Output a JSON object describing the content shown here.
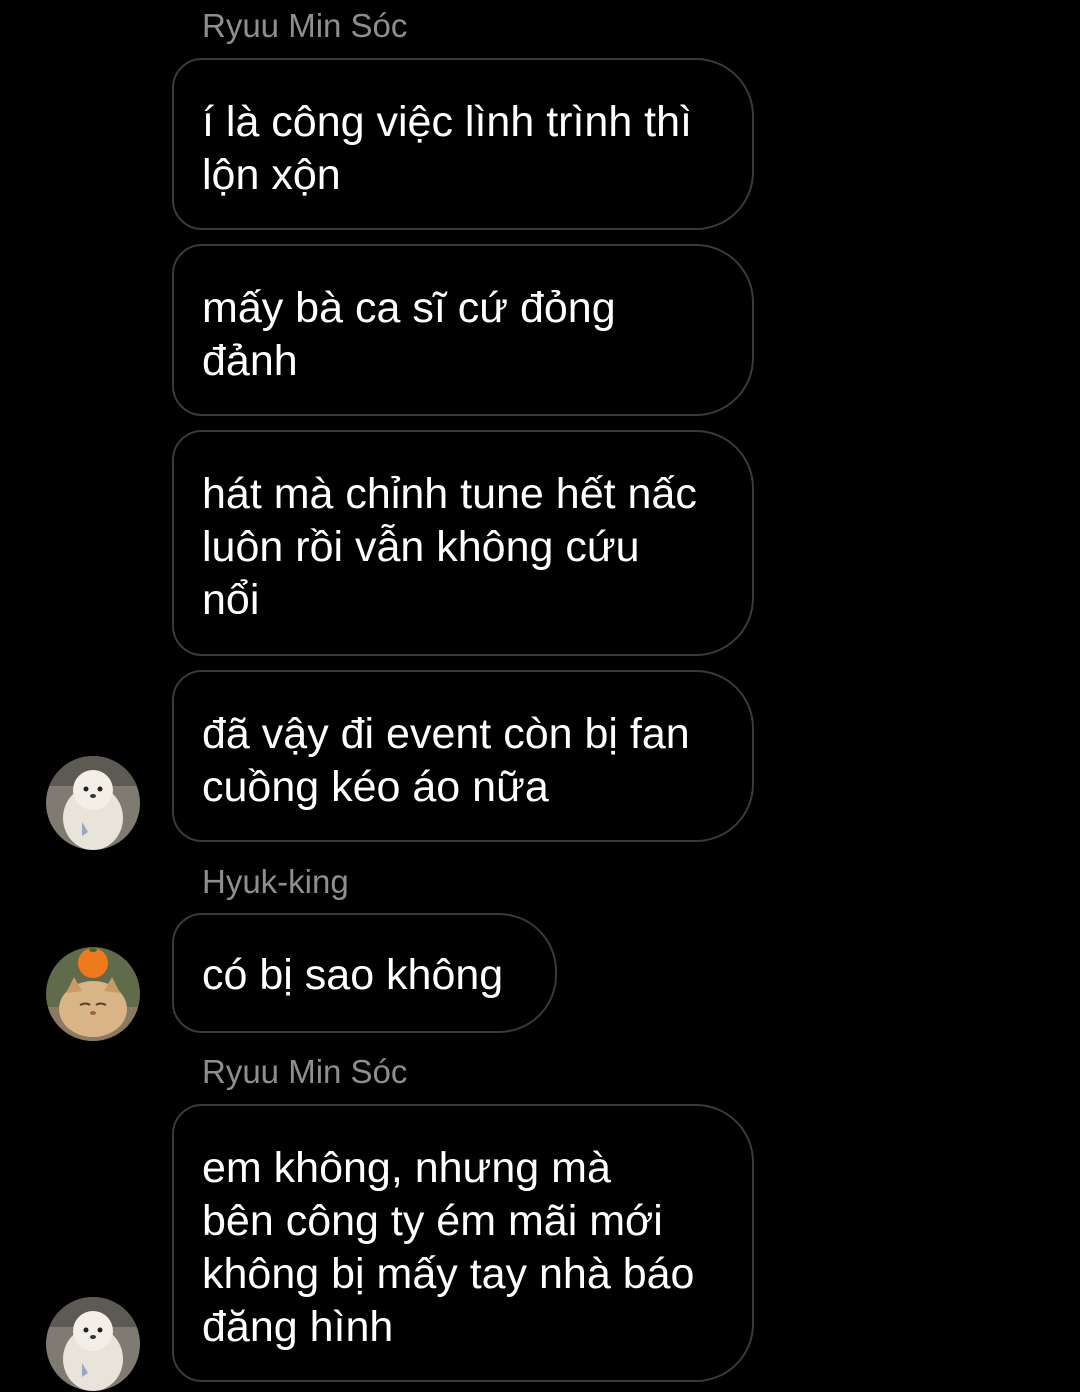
{
  "messages": [
    {
      "sender": "Ryuu Min Sóc"
    },
    {
      "text": "í là công việc lình trình thì\nlộn xộn"
    },
    {
      "text": "mấy bà ca sĩ cứ đỏng\nđảnh"
    },
    {
      "text": "hát mà chỉnh tune hết nấc\nluôn rồi vẫn không cứu\nnổi"
    },
    {
      "text": "đã vậy đi event còn bị fan\ncuồng kéo áo nữa"
    },
    {
      "sender": "Hyuk-king"
    },
    {
      "text": "có bị sao không"
    },
    {
      "sender": "Ryuu Min Sóc"
    },
    {
      "text": "em không, nhưng mà\nbên công ty ém mãi mới\nkhông bị mấy tay nhà báo\nđăng hình"
    }
  ],
  "avatars": {
    "ryuu": {
      "icon": "white-pomeranian-dog-avatar"
    },
    "hyuk": {
      "icon": "orange-cat-with-tangerine-avatar"
    }
  },
  "colors": {
    "background": "#000000",
    "bubble_border": "#3a3a3a",
    "sender_name": "#8e8e8e",
    "text": "#ffffff"
  }
}
